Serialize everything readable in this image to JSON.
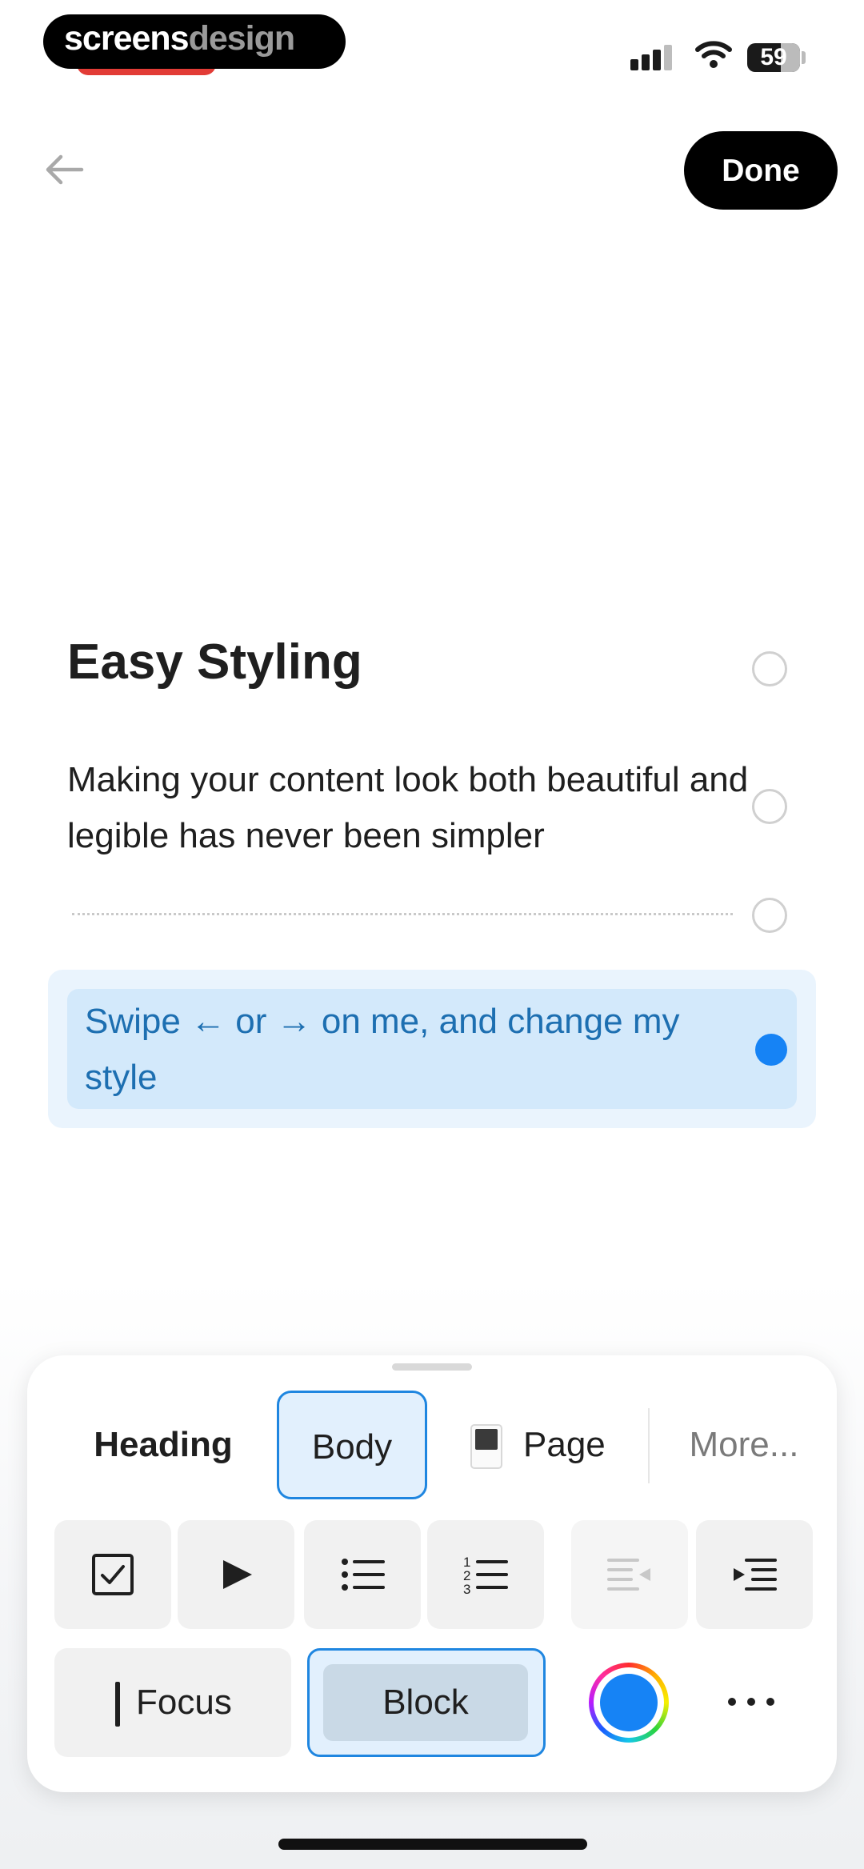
{
  "watermark": {
    "part1": "screens",
    "part2": "design"
  },
  "status_bar": {
    "battery": "59",
    "signal_icon": "signal-icon",
    "wifi_icon": "wifi-icon"
  },
  "nav": {
    "back_icon": "back-arrow-icon",
    "done_label": "Done"
  },
  "content": {
    "title": "Easy Styling",
    "body": "Making your content look both beautiful and legible has never been simpler",
    "block_text": "Swipe ← or → on me, and change my style"
  },
  "toolbar": {
    "styles": {
      "heading": "Heading",
      "body": "Body",
      "page": "Page",
      "more": "More...",
      "selected": "Body"
    },
    "tools": [
      {
        "icon": "checkbox-icon",
        "enabled": true
      },
      {
        "icon": "play-toggle-icon",
        "enabled": true
      },
      {
        "icon": "bullet-list-icon",
        "enabled": true
      },
      {
        "icon": "numbered-list-icon",
        "enabled": true
      },
      {
        "icon": "outdent-icon",
        "enabled": false
      },
      {
        "icon": "indent-icon",
        "enabled": true
      }
    ],
    "focus_label": "Focus",
    "block_label": "Block",
    "block_selected": true,
    "color_selected": "#1683F5",
    "more_icon": "more-icon"
  },
  "colors": {
    "accent": "#1683F5",
    "block_text": "#1D6FB1",
    "block_bg": "#D3E9FB"
  }
}
